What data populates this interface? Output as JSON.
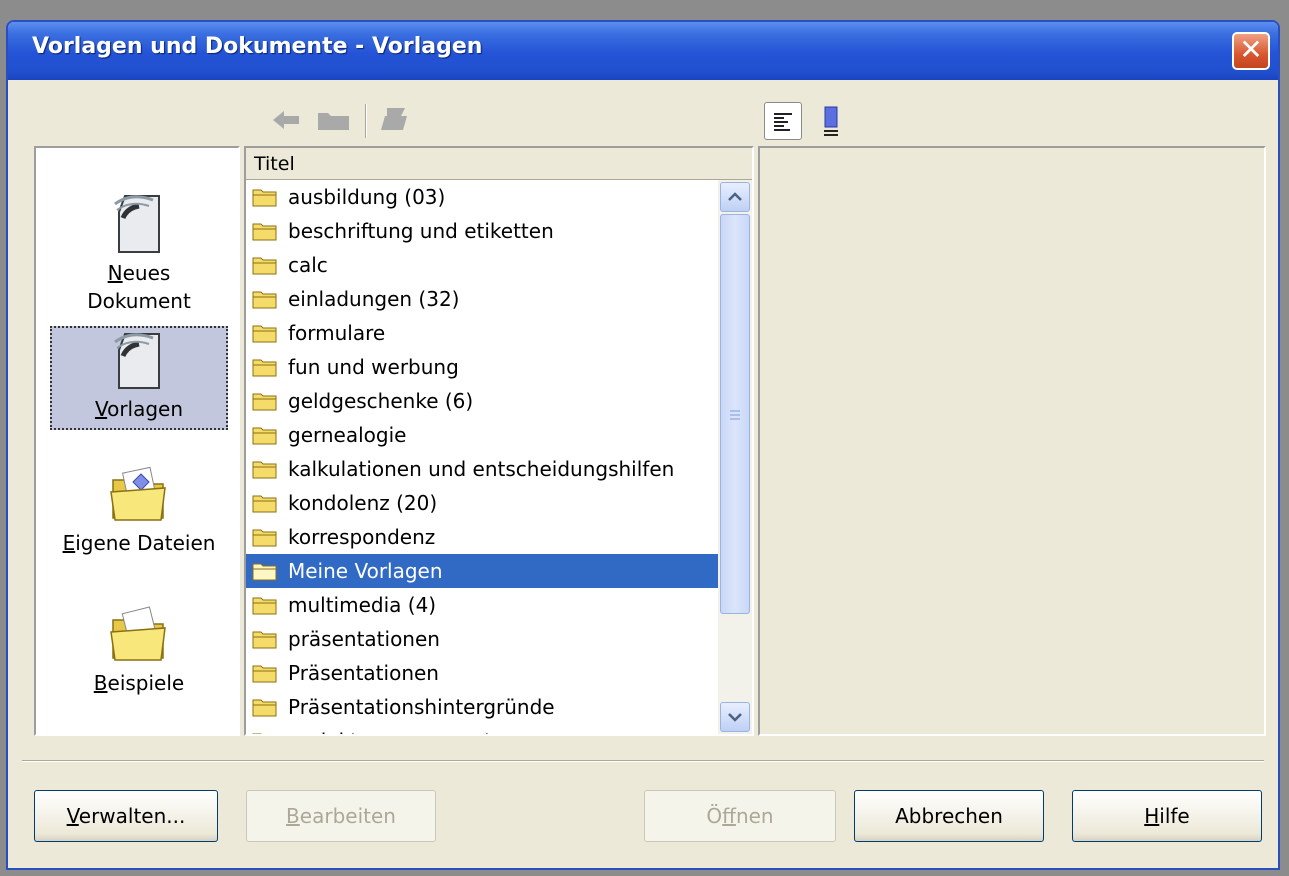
{
  "window": {
    "title": "Vorlagen und Dokumente - Vorlagen",
    "close_glyph": "✕"
  },
  "toolbar": {
    "left_icons": [
      "back-arrow-icon",
      "folder-up-icon",
      "print-icon"
    ],
    "right_icons": [
      "document-properties-icon",
      "preview-icon"
    ]
  },
  "nav": {
    "items": [
      {
        "label_first": "N",
        "label_rest": "eues",
        "label_line2": "Dokument",
        "icon": "new-document-icon"
      },
      {
        "label_first": "V",
        "label_rest": "orlagen",
        "icon": "templates-icon",
        "selected": true
      },
      {
        "label_first": "E",
        "label_rest": "igene Dateien",
        "icon": "my-documents-folder-icon"
      },
      {
        "label_first": "B",
        "label_rest": "eispiele",
        "icon": "samples-folder-icon"
      }
    ]
  },
  "list": {
    "header": "Titel",
    "items": [
      "ausbildung (03)",
      "beschriftung und etiketten",
      "calc",
      "einladungen (32)",
      "formulare",
      "fun und werbung",
      "geldgeschenke (6)",
      "gernealogie",
      "kalkulationen und entscheidungshilfen",
      "kondolenz (20)",
      "korrespondenz",
      "Meine Vorlagen",
      "multimedia (4)",
      "präsentationen",
      "Präsentationen",
      "Präsentationshintergründe",
      "projektmanagement"
    ],
    "selected_index": 11
  },
  "buttons": {
    "manage": {
      "first": "V",
      "rest": "erwalten..."
    },
    "edit": {
      "first": "B",
      "rest": "earbeiten"
    },
    "open": {
      "pre": "Ö",
      "under": "f",
      "rest": "fnen"
    },
    "cancel": "Abbrechen",
    "help": {
      "first": "H",
      "rest": "ilfe"
    }
  },
  "colors": {
    "selection": "#316ac5",
    "title_bar": "#2453d6",
    "dialog_bg": "#ece9d8"
  }
}
